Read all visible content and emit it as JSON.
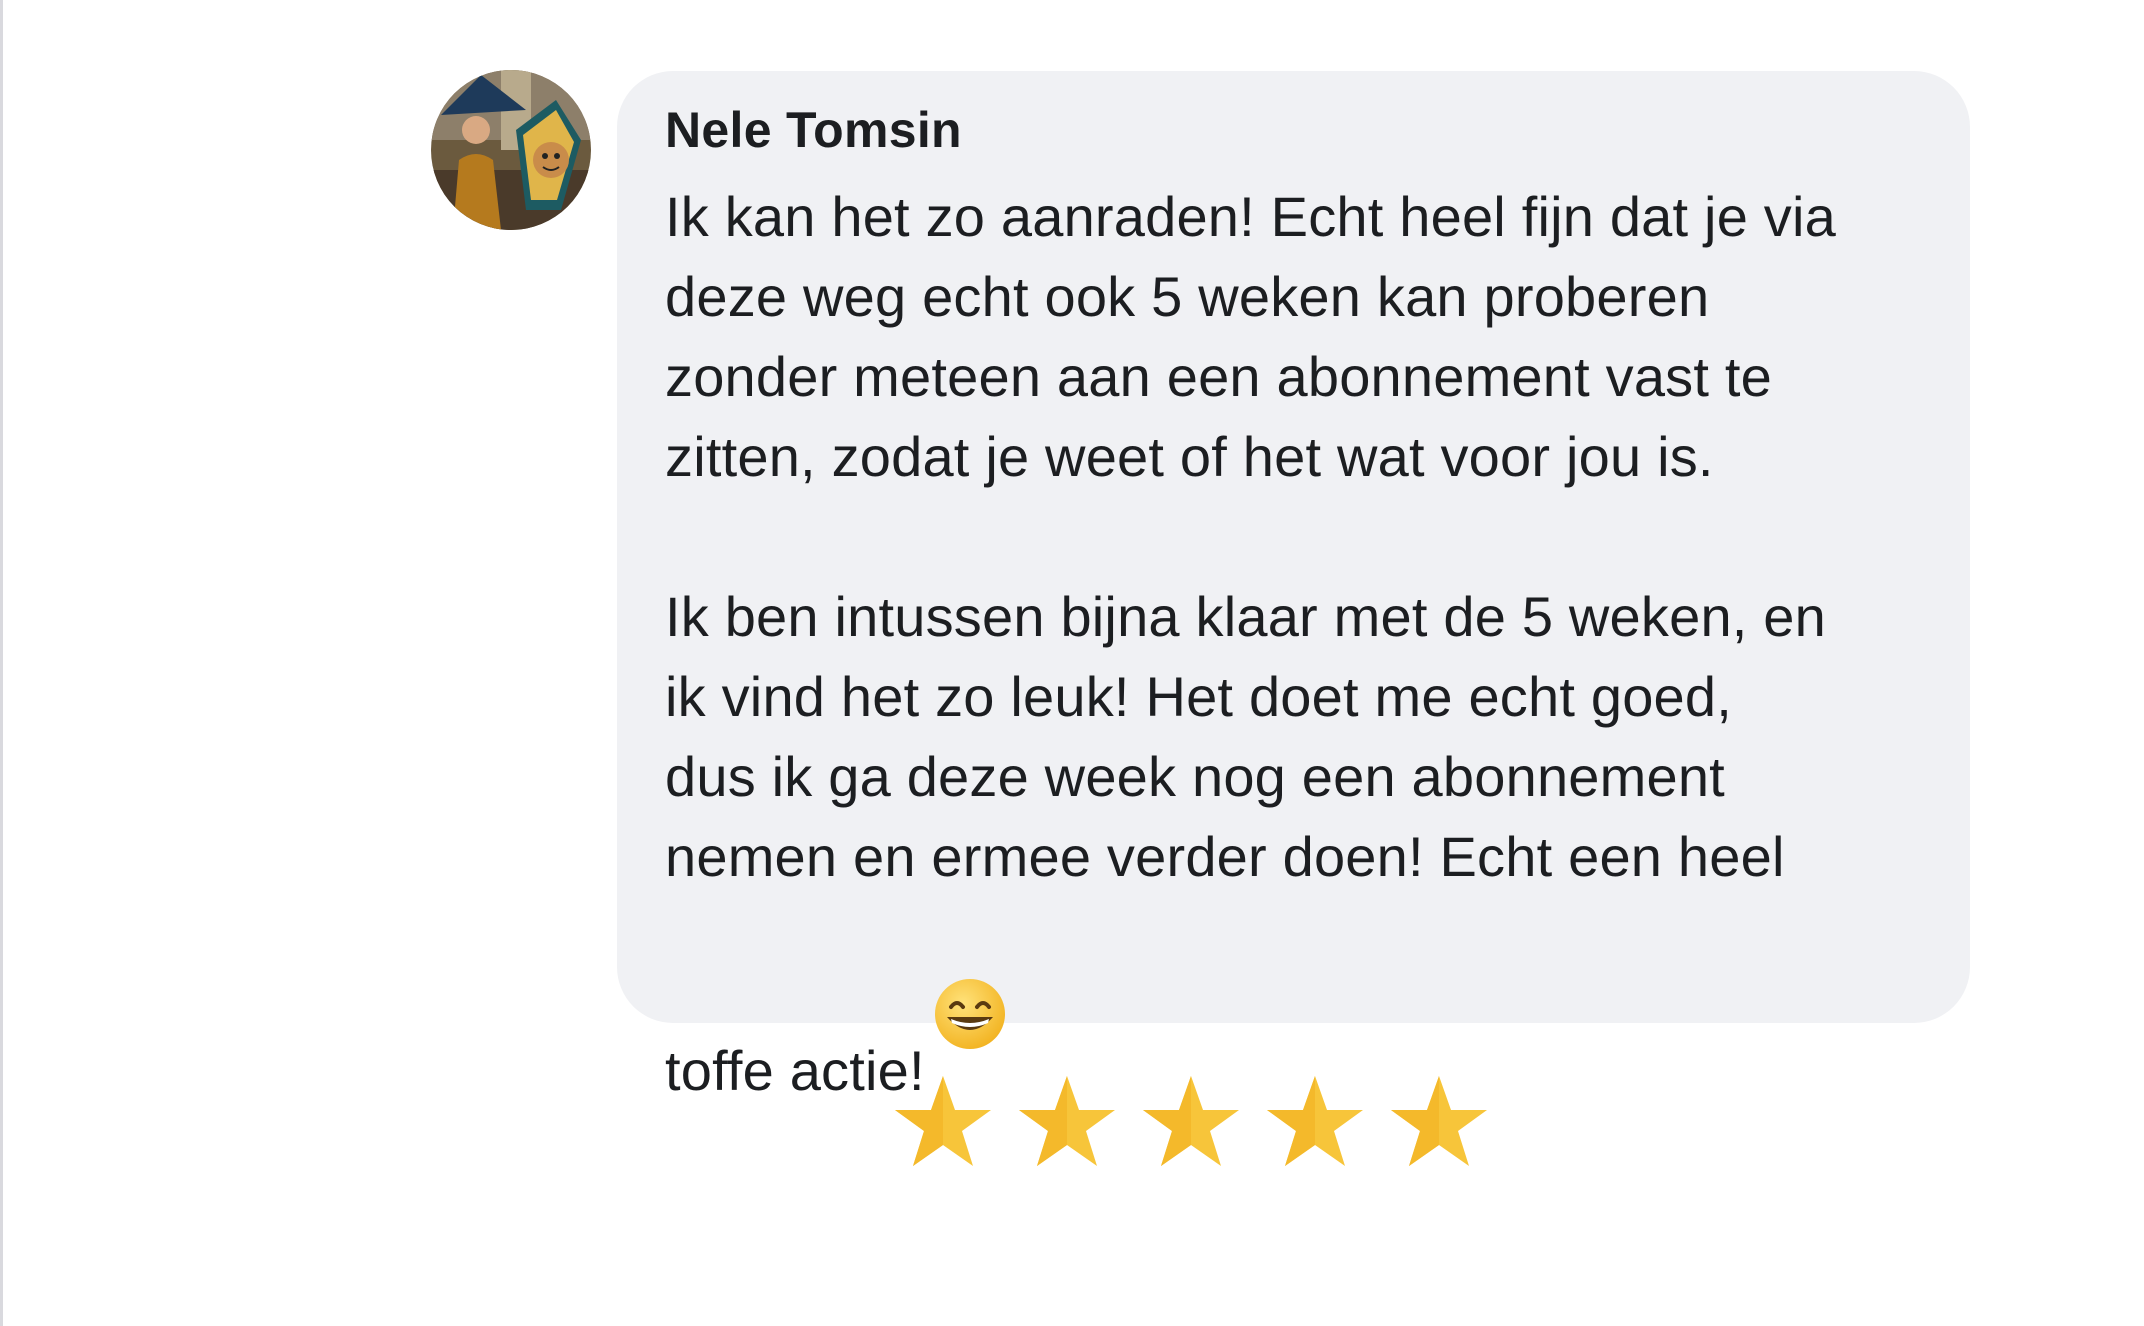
{
  "review": {
    "author": "Nele Tomsin",
    "paragraphs": [
      "Ik kan het zo aanraden! Echt heel fijn dat je via\ndeze weg echt ook 5 weken kan proberen\nzonder meteen aan een abonnement vast te\nzitten, zodat je weet of het wat voor jou is.",
      "Ik ben intussen bijna klaar met de 5 weken, en\nik vind het zo leuk! Het doet me echt goed,\ndus ik ga deze week nog een abonnement\nnemen en ermee verder doen! Echt een heel"
    ],
    "last_line": "toffe actie!",
    "emoji": "grinning-face-emoji"
  },
  "rating": {
    "stars": 5,
    "max": 5,
    "color": "#f7c53a"
  },
  "colors": {
    "bubble_background": "#f0f1f4",
    "text": "#1c1e21"
  }
}
